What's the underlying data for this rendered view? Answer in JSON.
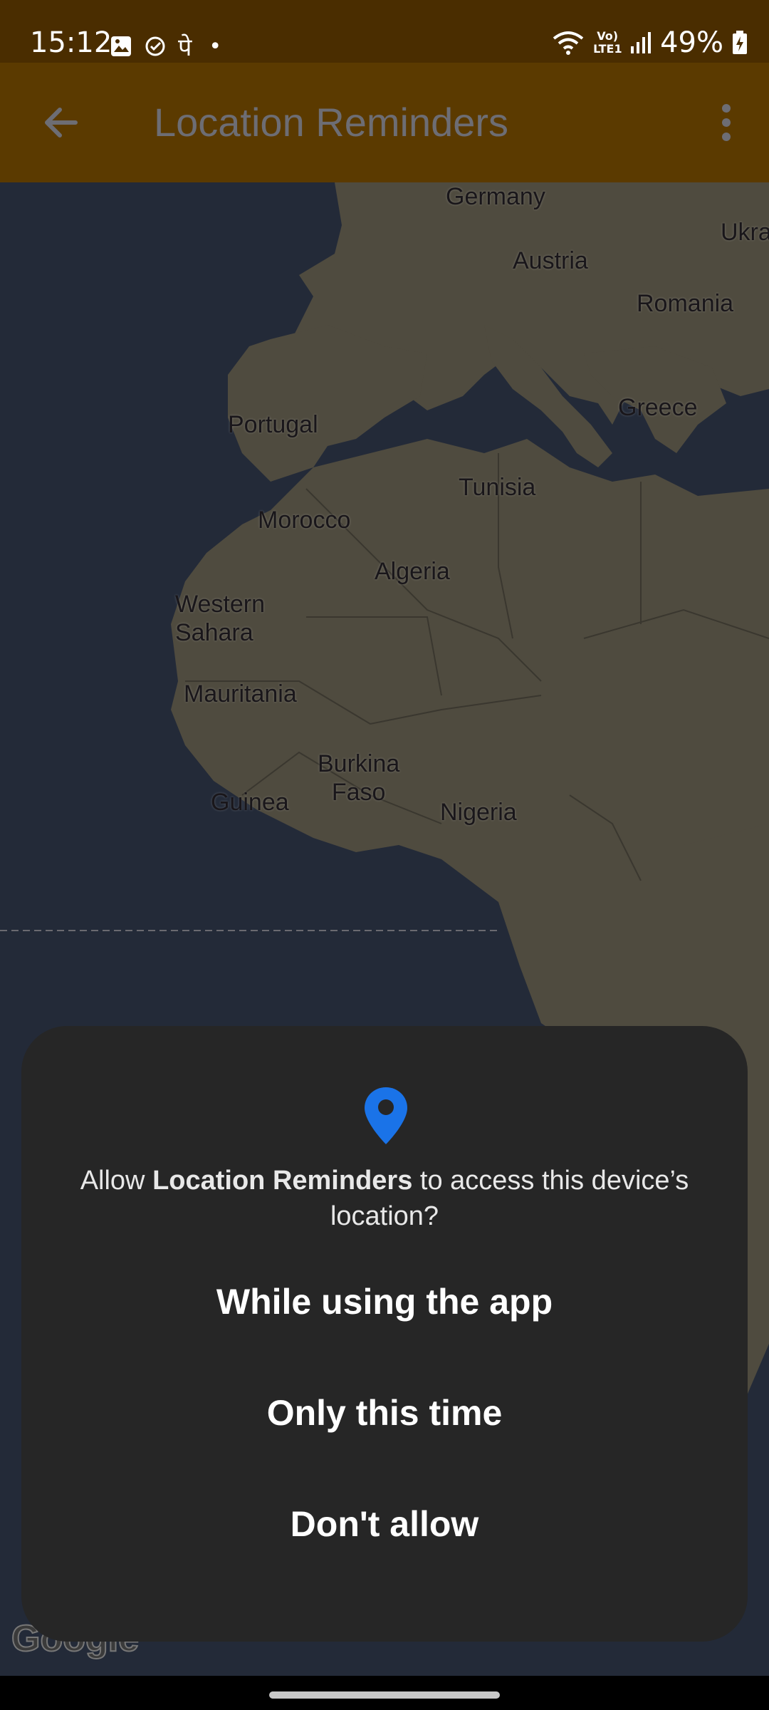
{
  "status_bar": {
    "time": "15:12",
    "devanagari_char": "पे",
    "dot": "•",
    "network_label": "Vo) LTE1",
    "battery": "49%"
  },
  "app_bar": {
    "title": "Location Reminders"
  },
  "map": {
    "labels": {
      "germany": "Germany",
      "austria": "Austria",
      "ukraine": "Ukra",
      "romania": "Romania",
      "portugal": "Portugal",
      "greece": "Greece",
      "tunisia": "Tunisia",
      "morocco": "Morocco",
      "algeria": "Algeria",
      "western_sahara": "Western\nSahara",
      "mauritania": "Mauritania",
      "burkina_faso": "Burkina\nFaso",
      "guinea": "Guinea",
      "nigeria": "Nigeria"
    },
    "attribution": "Google"
  },
  "dialog": {
    "message_prefix": "Allow ",
    "app_name": "Location Reminders",
    "message_suffix": " to access this device’s location?",
    "buttons": {
      "while_using": "While using the app",
      "only_this_time": "Only this time",
      "dont_allow": "Don't allow"
    }
  },
  "colors": {
    "status_bar": "#4a2d00",
    "app_bar": "#5b3a00",
    "water": "#232a38",
    "land": "#4f4b3f",
    "dialog_bg": "#262626",
    "pin": "#1a73e8"
  }
}
